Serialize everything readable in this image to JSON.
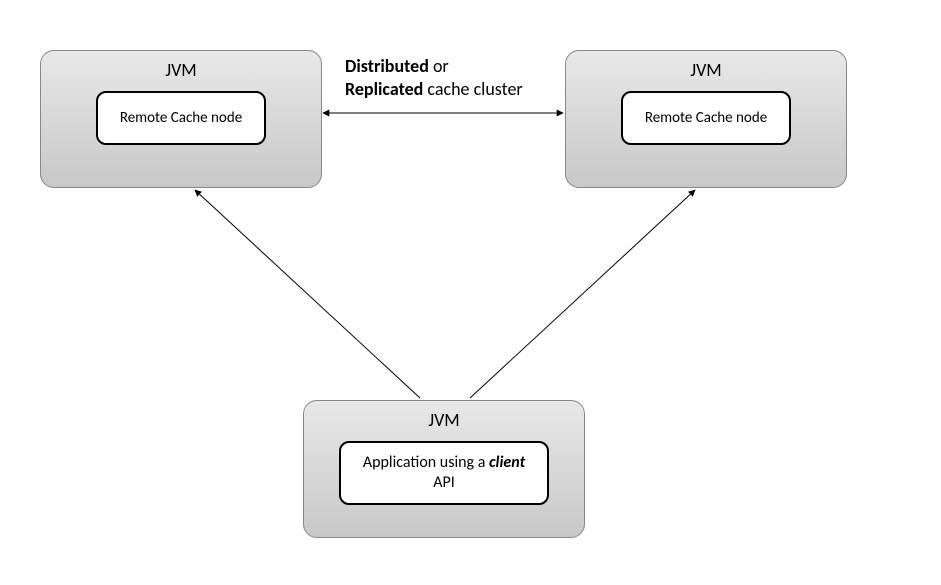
{
  "boxes": {
    "jvm_left": {
      "label": "JVM",
      "inner": "Remote Cache node"
    },
    "jvm_right": {
      "label": "JVM",
      "inner": "Remote Cache node"
    },
    "jvm_bottom": {
      "label": "JVM",
      "inner_prefix": "Application using a ",
      "inner_italic": "client",
      "inner_suffix": " API"
    }
  },
  "cluster_label": {
    "line1_bold": "Distributed",
    "line1_rest": " or",
    "line2_bold": "Replicated",
    "line2_rest": " cache cluster"
  }
}
